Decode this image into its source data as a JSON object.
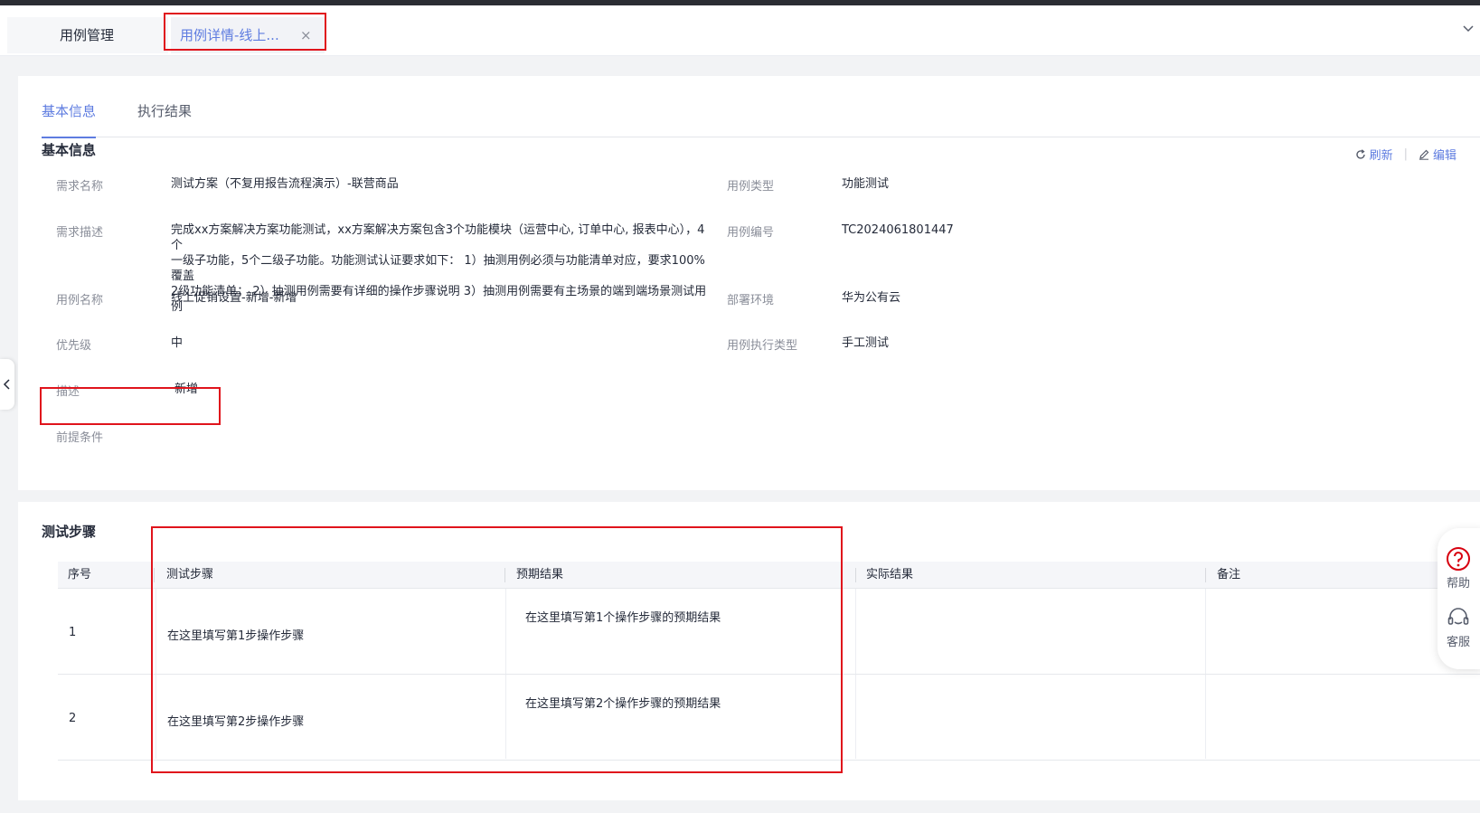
{
  "tabs": [
    {
      "label": "用例管理",
      "active": false
    },
    {
      "label": "用例详情-线上...",
      "active": true,
      "close": "×"
    }
  ],
  "subtabs": [
    "基本信息",
    "执行结果"
  ],
  "basic": {
    "title": "基本信息",
    "actions": {
      "refresh": "刷新",
      "edit": "编辑"
    },
    "fields": {
      "req_name": {
        "label": "需求名称",
        "value": "测试方案（不复用报告流程演示）-联营商品"
      },
      "case_type": {
        "label": "用例类型",
        "value": "功能测试"
      },
      "req_desc": {
        "label": "需求描述",
        "lines": [
          "完成xx方案解决方案功能测试，xx方案解决方案包含3个功能模块（运营中心, 订单中心, 报表中心），4个",
          "一级子功能，5个二级子功能。功能测试认证要求如下： 1）抽测用例必须与功能清单对应，要求100%覆盖",
          "2级功能清单； 2）抽测用例需要有详细的操作步骤说明 3）抽测用例需要有主场景的端到端场景测试用例"
        ]
      },
      "case_no": {
        "label": "用例编号",
        "value": "TC2024061801447"
      },
      "case_name": {
        "label": "用例名称",
        "value": "线上促销设置-新增-新增"
      },
      "deploy_env": {
        "label": "部署环境",
        "value": "华为公有云"
      },
      "priority": {
        "label": "优先级",
        "value": "中"
      },
      "exec_type": {
        "label": "用例执行类型",
        "value": "手工测试"
      },
      "desc": {
        "label": "描述",
        "value": "新增"
      },
      "precondition": {
        "label": "前提条件",
        "value": ""
      }
    }
  },
  "steps": {
    "title": "测试步骤",
    "columns": [
      "序号",
      "测试步骤",
      "预期结果",
      "实际结果",
      "备注"
    ],
    "rows": [
      {
        "no": "1",
        "step": "在这里填写第1步操作步骤",
        "expected": "在这里填写第1个操作步骤的预期结果",
        "actual": "",
        "note": ""
      },
      {
        "no": "2",
        "step": "在这里填写第2步操作步骤",
        "expected": "在这里填写第2个操作步骤的预期结果",
        "actual": "",
        "note": ""
      }
    ]
  },
  "float": {
    "help": "帮助",
    "service": "客服"
  },
  "colors": {
    "accent": "#5e7ce0",
    "highlight": "#e0141c",
    "background": "#f2f3f5"
  }
}
